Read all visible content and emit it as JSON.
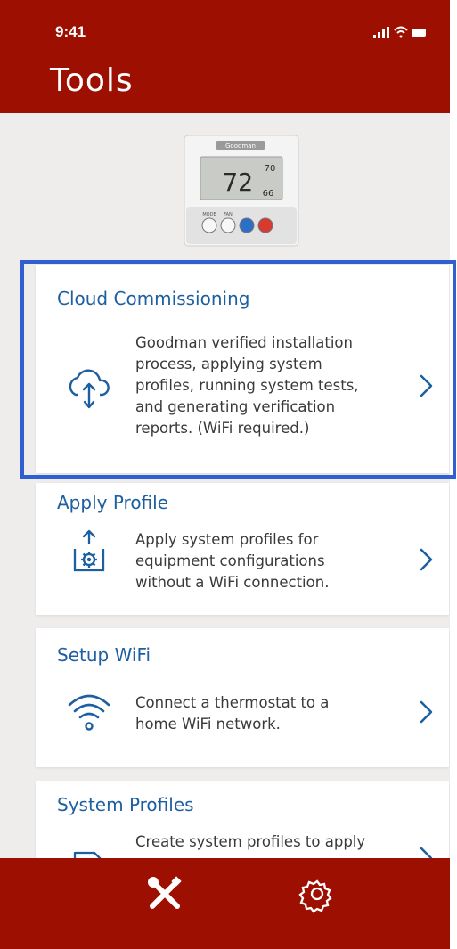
{
  "status_bar": {
    "time": "9:41"
  },
  "header": {
    "title": "Tools"
  },
  "device": {
    "brand": "Goodman",
    "display_value": "72",
    "display_set_high": "70",
    "display_set_low": "66",
    "button_labels": [
      "MODE",
      "FAN"
    ]
  },
  "cards": [
    {
      "title": "Cloud Commissioning",
      "description_lines": [
        "Goodman verified installation",
        "process, applying system",
        "profiles, running system tests,",
        "and generating verification",
        "reports. (WiFi required.)"
      ],
      "icon": "cloud-upload-icon"
    },
    {
      "title": "Apply Profile",
      "description_lines": [
        "Apply system profiles for",
        "equipment configurations",
        "without a WiFi connection."
      ],
      "icon": "profile-gear-upload-icon"
    },
    {
      "title": "Setup WiFi",
      "description_lines": [
        "Connect a thermostat to a",
        "home WiFi network."
      ],
      "icon": "wifi-icon"
    },
    {
      "title": "System Profiles",
      "description_lines": [
        "Create system profiles to apply"
      ],
      "icon": "document-gear-icon"
    }
  ],
  "tabbar": {
    "items": [
      "tools-icon",
      "settings-gear-icon"
    ]
  },
  "colors": {
    "brand_red": "#9d0f00",
    "title_blue": "#1e5fa0",
    "highlight_blue": "#2f5fd0"
  }
}
